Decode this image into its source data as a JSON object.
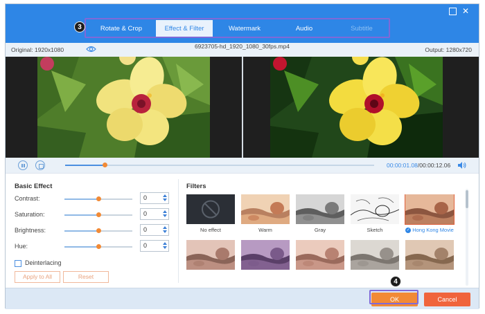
{
  "window": {
    "maximize_icon": "maximize-icon",
    "close_icon": "close-icon",
    "close_glyph": "✕"
  },
  "tabs": [
    {
      "label": "Rotate & Crop",
      "state": "normal"
    },
    {
      "label": "Effect & Filter",
      "state": "active"
    },
    {
      "label": "Watermark",
      "state": "normal"
    },
    {
      "label": "Audio",
      "state": "normal"
    },
    {
      "label": "Subtitle",
      "state": "dimmed"
    }
  ],
  "annotations": {
    "step_tabs": "3",
    "step_ok": "4",
    "highlight_color": "#7f69d8"
  },
  "info": {
    "original": "Original: 1920x1080",
    "filename": "6923705-hd_1920_1080_30fps.mp4",
    "output": "Output: 1280x720"
  },
  "playback": {
    "current": "00:00:01.08",
    "total": "/00:00:12.06",
    "progress": 0.13
  },
  "basic_effect": {
    "title": "Basic Effect",
    "rows": [
      {
        "label": "Contrast:",
        "value": "0",
        "slider": 0.5
      },
      {
        "label": "Saturation:",
        "value": "0",
        "slider": 0.5
      },
      {
        "label": "Brightness:",
        "value": "0",
        "slider": 0.5
      },
      {
        "label": "Hue:",
        "value": "0",
        "slider": 0.5
      }
    ],
    "deinterlacing": "Deinterlacing",
    "apply_all": "Apply to All",
    "reset": "Reset"
  },
  "filters": {
    "title": "Filters",
    "items": [
      {
        "label": "No effect",
        "style": "none",
        "selected": false
      },
      {
        "label": "Warm",
        "style": "warm",
        "selected": false
      },
      {
        "label": "Gray",
        "style": "gray",
        "selected": false
      },
      {
        "label": "Sketch",
        "style": "sketch",
        "selected": false
      },
      {
        "label": "Hong Kong Movie",
        "style": "hk",
        "selected": true
      },
      {
        "label": "",
        "style": "rose",
        "selected": false
      },
      {
        "label": "",
        "style": "purple",
        "selected": false
      },
      {
        "label": "",
        "style": "pink",
        "selected": false
      },
      {
        "label": "",
        "style": "cool",
        "selected": false
      },
      {
        "label": "",
        "style": "sepia",
        "selected": false
      }
    ]
  },
  "footer": {
    "ok": "OK",
    "cancel": "Cancel"
  },
  "colors": {
    "header": "#2e86e6",
    "accent_orange": "#f28a35",
    "cancel": "#f0643c"
  }
}
